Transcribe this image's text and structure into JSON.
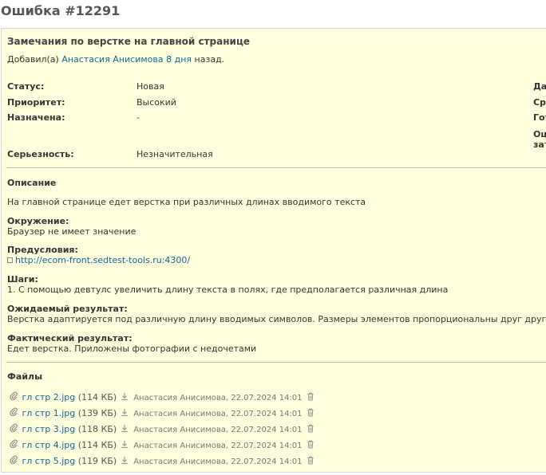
{
  "title": "Ошибка #12291",
  "subject": "Замечания по верстке на главной странице",
  "author": {
    "prefix": "Добавил(а)",
    "name": "Анастасия Анисимова",
    "ago": "8 дня",
    "suffix": "назад."
  },
  "attributes": [
    {
      "label": "Статус:",
      "value": "Новая"
    },
    {
      "label": "Приоритет:",
      "value": "Высокий"
    },
    {
      "label": "Назначена:",
      "value": "-"
    },
    {
      "label": "Серьезность:",
      "value": "Незначительная"
    }
  ],
  "right_attributes": [
    "Дат",
    "Сро",
    "Гот",
    "Оце",
    "зат"
  ],
  "description": {
    "title": "Описание",
    "text": "На главной странице едет верстка при различных длинах вводимого текста",
    "environment_label": "Окружение:",
    "environment_text": "Браузер не имеет значение",
    "preconditions_label": "Предусловия:",
    "preconditions_link": "http://ecom-front.sedtest-tools.ru:4300/",
    "steps_label": "Шаги:",
    "steps_text": "1. С помощью девтулс увеличить длину текста в полях, где предполагается различная длина",
    "expected_label": "Ожидаемый результат:",
    "expected_text": "Верстка адаптируется под различную длину вводимых символов. Размеры элементов пропорциональны друг другу",
    "actual_label": "Фактический результат:",
    "actual_text": "Едет верстка. Приложены фотографии с недочетами"
  },
  "files": {
    "title": "Файлы",
    "items": [
      {
        "name": "гл стр 2.jpg",
        "size": "(114 КБ)",
        "meta": "Анастасия Анисимова, 22.07.2024 14:01"
      },
      {
        "name": "гл стр 1.jpg",
        "size": "(139 КБ)",
        "meta": "Анастасия Анисимова, 22.07.2024 14:01"
      },
      {
        "name": "гл стр 3.jpg",
        "size": "(118 КБ)",
        "meta": "Анастасия Анисимова, 22.07.2024 14:01"
      },
      {
        "name": "гл стр 4.jpg",
        "size": "(114 КБ)",
        "meta": "Анастасия Анисимова, 22.07.2024 14:01"
      },
      {
        "name": "гл стр 5.jpg",
        "size": "(119 КБ)",
        "meta": "Анастасия Анисимова, 22.07.2024 14:01"
      }
    ]
  },
  "colors": {
    "box_background": "#ffffdd",
    "link": "#116699",
    "title": "#555555"
  },
  "icons": [
    "paperclip-icon",
    "download-icon",
    "trash-icon",
    "external-link-icon"
  ]
}
